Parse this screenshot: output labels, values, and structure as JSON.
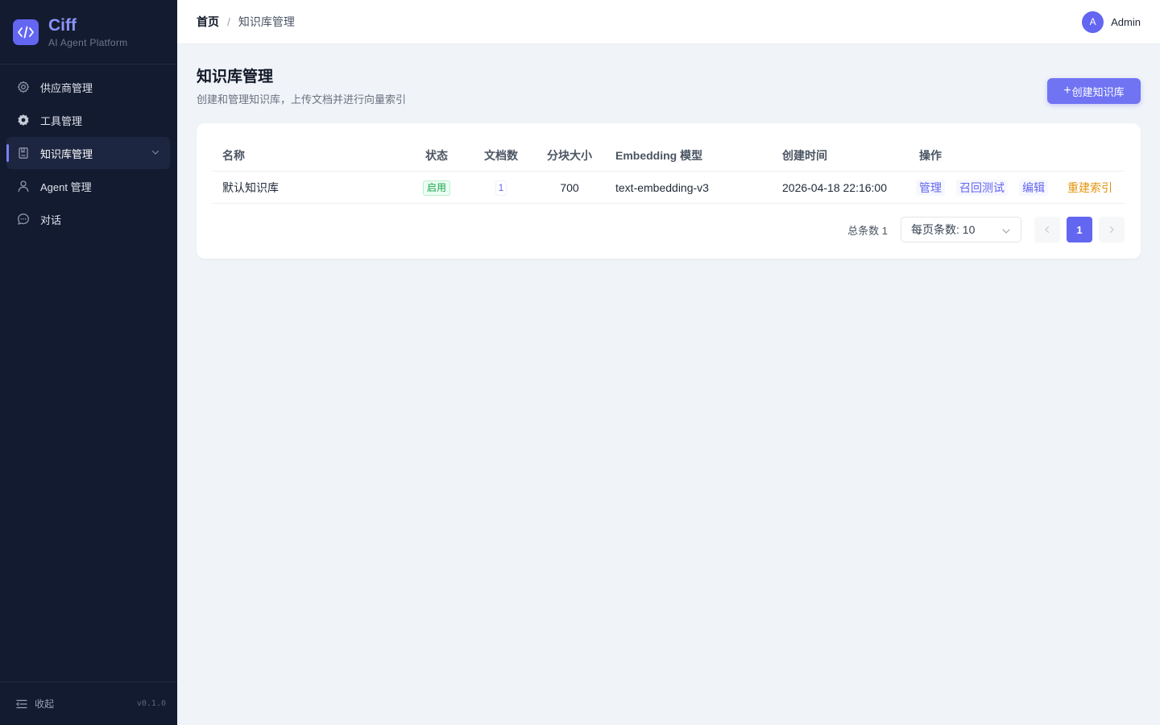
{
  "brand": {
    "name": "Ciff",
    "subtitle": "AI Agent Platform"
  },
  "sidebar": {
    "items": [
      {
        "label": "供应商管理",
        "icon": "gear-icon",
        "active": false
      },
      {
        "label": "工具管理",
        "icon": "puzzle-icon",
        "active": false
      },
      {
        "label": "知识库管理",
        "icon": "book-icon",
        "active": true
      },
      {
        "label": "Agent 管理",
        "icon": "user-icon",
        "active": false
      },
      {
        "label": "对话",
        "icon": "chat-icon",
        "active": false
      }
    ],
    "collapse_label": "收起",
    "version": "v0.1.0"
  },
  "header": {
    "breadcrumb": {
      "home": "首页",
      "separator": "/",
      "current": "知识库管理"
    },
    "user": {
      "initial": "A",
      "name": "Admin"
    }
  },
  "page": {
    "title": "知识库管理",
    "description": "创建和管理知识库，上传文档并进行向量索引",
    "create_button": {
      "plus": "+",
      "label": "创建知识库"
    }
  },
  "table": {
    "columns": [
      "名称",
      "状态",
      "文档数",
      "分块大小",
      "Embedding 模型",
      "创建时间",
      "操作"
    ],
    "rows": [
      {
        "name": "默认知识库",
        "status": "启用",
        "doc_count": "1",
        "chunk_size": "700",
        "model": "text-embedding-v3",
        "created_at": "2026-04-18 22:16:00",
        "actions": [
          "管理",
          "召回测试",
          "编辑",
          "重建索引"
        ]
      }
    ]
  },
  "pagination": {
    "total_label": "总条数 1",
    "page_size_label": "每页条数: 10",
    "current_page": "1"
  },
  "colors": {
    "accent": "#6366f1",
    "sidebar_bg": "#131b30",
    "success": "#16a34a",
    "warning": "#e29612"
  }
}
